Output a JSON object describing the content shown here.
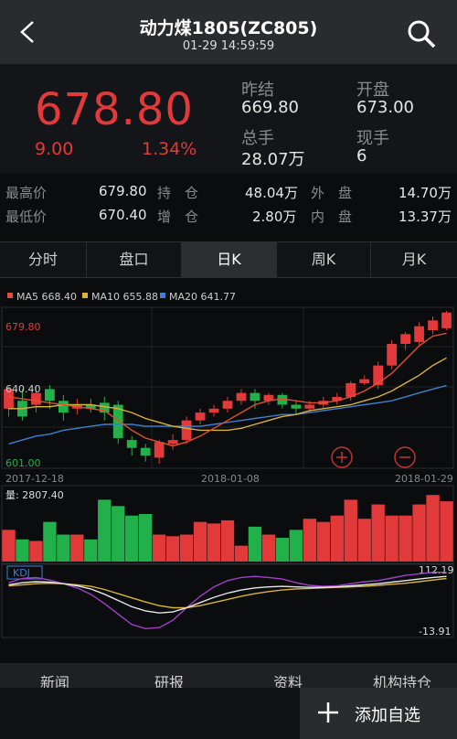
{
  "header": {
    "title": "动力煤1805(ZC805)",
    "datetime": "01-29 14:59:59"
  },
  "quote": {
    "price": "678.80",
    "change": "9.00",
    "change_pct": "1.34%",
    "prev_settle_label": "昨结",
    "prev_settle": "669.80",
    "open_label": "开盘",
    "open": "673.00",
    "total_vol_label": "总手",
    "total_vol": "28.07万",
    "cur_vol_label": "现手",
    "cur_vol": "6"
  },
  "stats": {
    "high_label": "最高价",
    "high": "679.80",
    "low_label": "最低价",
    "low": "670.40",
    "oi_label": "持　仓",
    "oi": "48.04万",
    "inc_label": "增　仓",
    "inc": "2.80万",
    "outer_label": "外　盘",
    "outer": "14.70万",
    "inner_label": "内　盘",
    "inner": "13.37万"
  },
  "tabs": [
    "分时",
    "盘口",
    "日K",
    "周K",
    "月K"
  ],
  "active_tab": 2,
  "bottom_tabs": [
    "新闻",
    "研报",
    "资料",
    "机构持仓"
  ],
  "add_label": "添加自选",
  "colors": {
    "up": "#e23a3a",
    "down": "#22b04b",
    "ma5": "#e0502f",
    "ma10": "#d8b23a",
    "ma20": "#3f7fd1"
  },
  "chart_data": {
    "type": "candlestick",
    "legend": [
      {
        "name": "MA5",
        "value": "668.40"
      },
      {
        "name": "MA10",
        "value": "655.88"
      },
      {
        "name": "MA20",
        "value": "641.77"
      }
    ],
    "price_high_label": "679.80",
    "price_mid_label": "640.40",
    "price_low_label": "601.00",
    "ylim": [
      601.0,
      679.8
    ],
    "dates": [
      "2017-12-18",
      "2018-01-08",
      "2018-01-29"
    ],
    "candles": [
      {
        "o": 630,
        "c": 640,
        "h": 641,
        "l": 626
      },
      {
        "o": 634,
        "c": 626,
        "h": 640,
        "l": 624
      },
      {
        "o": 632,
        "c": 638,
        "h": 641,
        "l": 628
      },
      {
        "o": 640,
        "c": 634,
        "h": 642,
        "l": 630
      },
      {
        "o": 634,
        "c": 628,
        "h": 637,
        "l": 624
      },
      {
        "o": 630,
        "c": 632,
        "h": 635,
        "l": 627
      },
      {
        "o": 632,
        "c": 630,
        "h": 635,
        "l": 628
      },
      {
        "o": 633,
        "c": 628,
        "h": 636,
        "l": 624
      },
      {
        "o": 632,
        "c": 615,
        "h": 634,
        "l": 612
      },
      {
        "o": 614,
        "c": 610,
        "h": 616,
        "l": 606
      },
      {
        "o": 610,
        "c": 606,
        "h": 612,
        "l": 603
      },
      {
        "o": 605,
        "c": 613,
        "h": 614,
        "l": 602
      },
      {
        "o": 612,
        "c": 614,
        "h": 617,
        "l": 609
      },
      {
        "o": 614,
        "c": 624,
        "h": 626,
        "l": 612
      },
      {
        "o": 624,
        "c": 628,
        "h": 630,
        "l": 622
      },
      {
        "o": 628,
        "c": 630,
        "h": 632,
        "l": 626
      },
      {
        "o": 630,
        "c": 634,
        "h": 636,
        "l": 628
      },
      {
        "o": 634,
        "c": 638,
        "h": 640,
        "l": 632
      },
      {
        "o": 638,
        "c": 634,
        "h": 640,
        "l": 630
      },
      {
        "o": 634,
        "c": 637,
        "h": 638,
        "l": 632
      },
      {
        "o": 637,
        "c": 632,
        "h": 638,
        "l": 630
      },
      {
        "o": 632,
        "c": 630,
        "h": 634,
        "l": 627
      },
      {
        "o": 630,
        "c": 632,
        "h": 634,
        "l": 628
      },
      {
        "o": 632,
        "c": 634,
        "h": 636,
        "l": 630
      },
      {
        "o": 634,
        "c": 636,
        "h": 638,
        "l": 632
      },
      {
        "o": 636,
        "c": 643,
        "h": 644,
        "l": 634
      },
      {
        "o": 643,
        "c": 645,
        "h": 647,
        "l": 642
      },
      {
        "o": 642,
        "c": 652,
        "h": 654,
        "l": 640
      },
      {
        "o": 652,
        "c": 663,
        "h": 665,
        "l": 650
      },
      {
        "o": 663,
        "c": 668,
        "h": 669,
        "l": 660
      },
      {
        "o": 664,
        "c": 672,
        "h": 674,
        "l": 662
      },
      {
        "o": 670,
        "c": 675,
        "h": 677,
        "l": 668
      },
      {
        "o": 671,
        "c": 679,
        "h": 679.8,
        "l": 670
      }
    ],
    "ma5": [
      636,
      635,
      634,
      633,
      632,
      631,
      630,
      629,
      624,
      619,
      615,
      613,
      611,
      613,
      616,
      620,
      624,
      628,
      632,
      634,
      635,
      634,
      633,
      633,
      634,
      636,
      639,
      643,
      648,
      655,
      662,
      667,
      668.4
    ],
    "ma10": [
      630,
      630,
      631,
      631,
      632,
      632,
      632,
      631,
      630,
      628,
      625,
      623,
      621,
      620,
      619,
      619,
      619,
      620,
      622,
      624,
      626,
      627,
      629,
      630,
      631,
      632,
      634,
      636,
      639,
      643,
      647,
      652,
      655.88
    ],
    "ma20": [
      612,
      614,
      616,
      617,
      619,
      620,
      621,
      622,
      622,
      622,
      621,
      621,
      621,
      621,
      621,
      622,
      623,
      624,
      625,
      626,
      627,
      627,
      628,
      629,
      630,
      631,
      632,
      633,
      634,
      636,
      638,
      640,
      641.77
    ],
    "volume_label": "量: 2807.40",
    "volumes": [
      2000,
      1400,
      1300,
      2500,
      1700,
      1700,
      1400,
      3900,
      3500,
      2900,
      3000,
      1700,
      1600,
      1700,
      2500,
      2400,
      2600,
      1000,
      2200,
      1700,
      1500,
      2000,
      2700,
      2500,
      2900,
      3900,
      2700,
      3600,
      2900,
      2900,
      3600,
      4200,
      3800
    ],
    "kdj_label": "KDJ",
    "kdj_max_label": "112.19",
    "kdj_min_label": "-13.91",
    "kdj_range": [
      -13.91,
      112.19
    ],
    "k": [
      80,
      84,
      86,
      85,
      82,
      78,
      72,
      62,
      50,
      38,
      30,
      26,
      28,
      36,
      46,
      56,
      64,
      70,
      74,
      76,
      77,
      76,
      75,
      75,
      76,
      78,
      80,
      82,
      85,
      88,
      91,
      94,
      96
    ],
    "d": [
      78,
      80,
      82,
      83,
      82,
      80,
      77,
      71,
      63,
      55,
      47,
      40,
      36,
      36,
      40,
      46,
      52,
      58,
      63,
      67,
      70,
      72,
      73,
      74,
      75,
      76,
      77,
      79,
      81,
      83,
      86,
      89,
      92
    ],
    "j": [
      84,
      92,
      94,
      89,
      82,
      74,
      62,
      44,
      24,
      4,
      -4,
      -2,
      12,
      36,
      58,
      76,
      88,
      94,
      96,
      94,
      91,
      84,
      79,
      77,
      78,
      82,
      86,
      88,
      93,
      98,
      101,
      104,
      104
    ]
  }
}
